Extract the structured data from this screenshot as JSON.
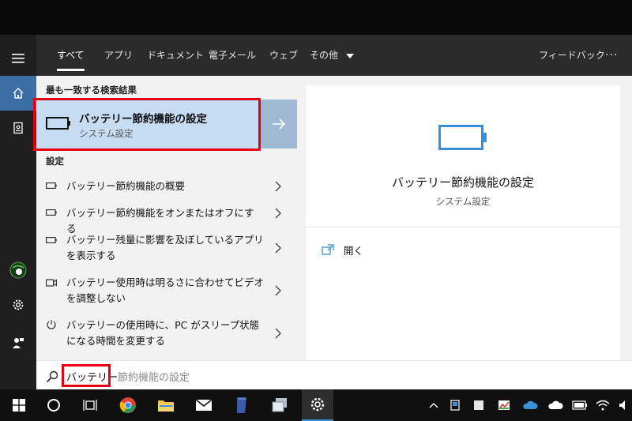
{
  "tabs": {
    "all": "すべて",
    "apps": "アプリ",
    "documents": "ドキュメント",
    "email": "電子メール",
    "web": "ウェブ",
    "more": "その他",
    "feedback": "フィードバック",
    "overflow": "···"
  },
  "best_match": {
    "header": "最も一致する検索結果",
    "title": "バッテリー節約機能の設定",
    "subtitle": "システム設定"
  },
  "settings": {
    "header": "設定",
    "items": [
      {
        "line1": "バッテリー節約機能の概要",
        "line2": ""
      },
      {
        "line1": "バッテリー節約機能をオンまたはオフにする",
        "line2": ""
      },
      {
        "line1": "バッテリー残量に影響を及ぼしているアプリ",
        "line2": "を表示する"
      },
      {
        "line1": "バッテリー使用時は明るさに合わせてビデオ",
        "line2": "を調整しない"
      },
      {
        "line1": "バッテリーの使用時に、PC がスリープ状態",
        "line2": "になる時間を変更する"
      }
    ]
  },
  "preview": {
    "title": "バッテリー節約機能の設定",
    "subtitle": "システム設定",
    "open_label": "開く"
  },
  "search": {
    "typed": "バッテリー",
    "suggestion": "節約機能の設定"
  },
  "colors": {
    "accent": "#3a8fd6",
    "highlight": "#e60012"
  }
}
